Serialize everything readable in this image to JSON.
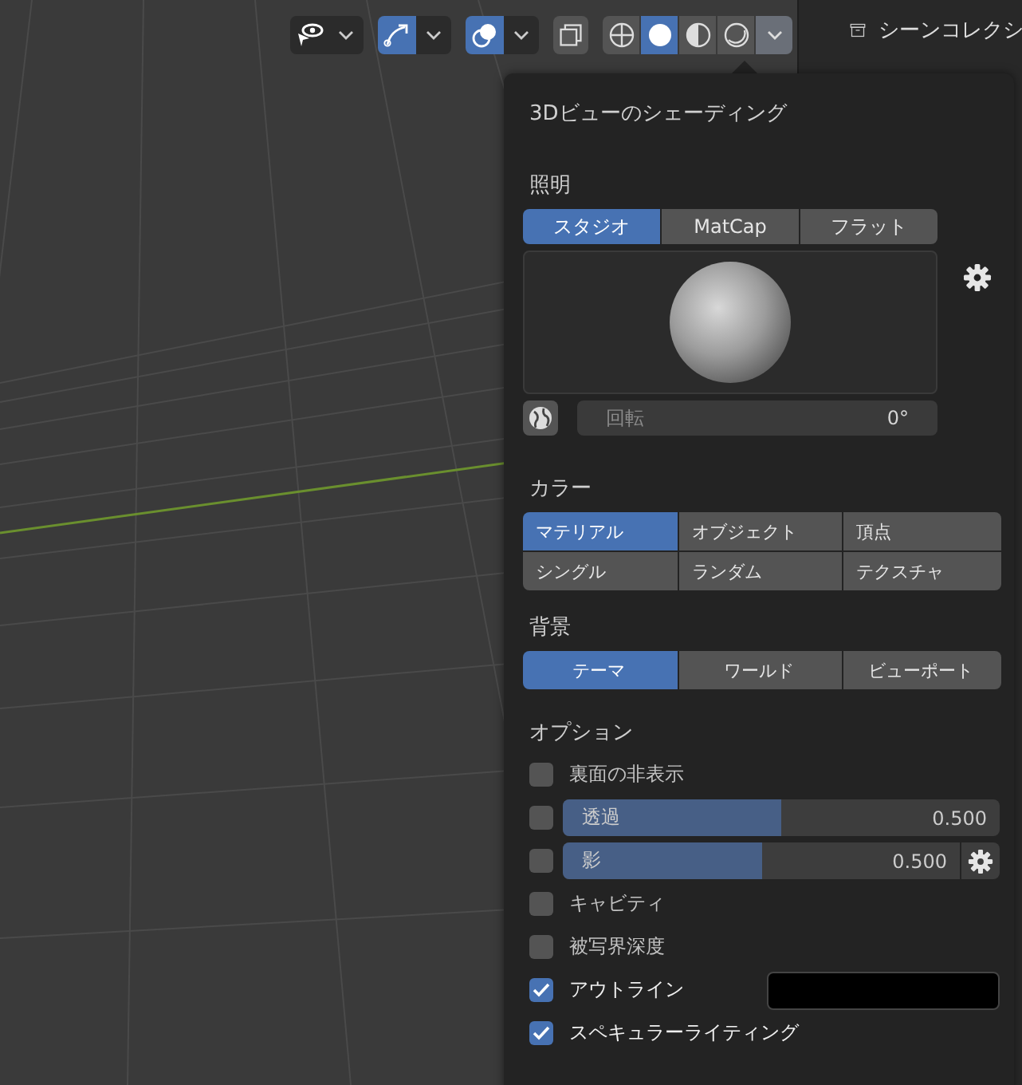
{
  "toolbar": {
    "toggles": [
      {
        "kind": "visibility",
        "selected": false
      },
      {
        "kind": "gizmo",
        "selected": true
      },
      {
        "kind": "overlay",
        "selected": true
      }
    ],
    "shading_modes": [
      {
        "kind": "wireframe",
        "selected": false
      },
      {
        "kind": "solid",
        "selected": true
      },
      {
        "kind": "material",
        "selected": false
      },
      {
        "kind": "rendered",
        "selected": false
      }
    ]
  },
  "outliner": {
    "title": "シーンコレクシ"
  },
  "popup": {
    "title": "3Dビューのシェーディング",
    "lighting": {
      "label": "照明",
      "options": [
        {
          "label": "スタジオ",
          "selected": true
        },
        {
          "label": "MatCap",
          "selected": false
        },
        {
          "label": "フラット",
          "selected": false
        }
      ],
      "rotation": {
        "label": "回転",
        "value": "0°"
      }
    },
    "color": {
      "label": "カラー",
      "options": [
        {
          "label": "マテリアル",
          "selected": true
        },
        {
          "label": "オブジェクト",
          "selected": false
        },
        {
          "label": "頂点",
          "selected": false
        },
        {
          "label": "シングル",
          "selected": false
        },
        {
          "label": "ランダム",
          "selected": false
        },
        {
          "label": "テクスチャ",
          "selected": false
        }
      ]
    },
    "background": {
      "label": "背景",
      "options": [
        {
          "label": "テーマ",
          "selected": true
        },
        {
          "label": "ワールド",
          "selected": false
        },
        {
          "label": "ビューポート",
          "selected": false
        }
      ]
    },
    "options": {
      "label": "オプション",
      "items": [
        {
          "kind": "checkbox",
          "label": "裏面の非表示",
          "checked": false
        },
        {
          "kind": "slider",
          "label": "透過",
          "value": "0.500",
          "level": 0.5,
          "checked": false
        },
        {
          "kind": "slider_settings",
          "label": "影",
          "value": "0.500",
          "level": 0.5,
          "checked": false
        },
        {
          "kind": "checkbox",
          "label": "キャビティ",
          "checked": false
        },
        {
          "kind": "checkbox",
          "label": "被写界深度",
          "checked": false
        },
        {
          "kind": "checkbox_swatch",
          "label": "アウトライン",
          "checked": true
        },
        {
          "kind": "checkbox",
          "label": "スペキュラーライティング",
          "checked": true
        }
      ]
    }
  }
}
